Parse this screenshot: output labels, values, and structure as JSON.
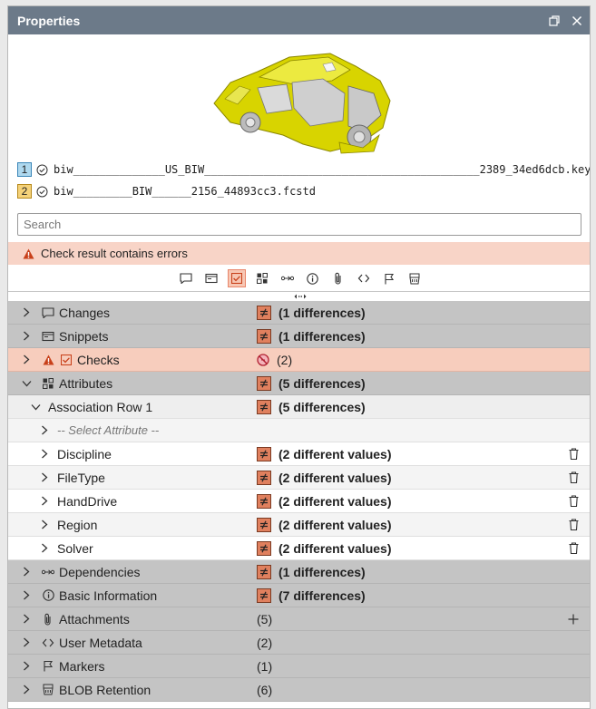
{
  "window": {
    "title": "Properties"
  },
  "files": [
    {
      "index": "1",
      "name": "biw______________US_BIW__________________________________________2389_34ed6dcb.key",
      "bg": "#aed8ee",
      "border": "#3a86b8"
    },
    {
      "index": "2",
      "name": "biw_________BIW______2156_44893cc3.fcstd",
      "bg": "#f5d27a",
      "border": "#b78a1c"
    }
  ],
  "search": {
    "placeholder": "Search",
    "value": ""
  },
  "error_banner": {
    "text": "Check result contains errors"
  },
  "toolbar": {
    "icons": [
      "changes-icon",
      "snippets-icon",
      "checks-icon",
      "attributes-icon",
      "dependencies-icon",
      "info-icon",
      "attachments-icon",
      "metadata-icon",
      "markers-icon",
      "blob-retention-icon"
    ],
    "active": "checks-icon"
  },
  "tree": {
    "changes": {
      "label": "Changes",
      "value": "(1 differences)"
    },
    "snippets": {
      "label": "Snippets",
      "value": "(1 differences)"
    },
    "checks": {
      "label": "Checks",
      "value": "(2)"
    },
    "attributes": {
      "label": "Attributes",
      "value": "(5 differences)"
    },
    "association_row": {
      "label": "Association Row 1",
      "value": "(5 differences)"
    },
    "select_attribute": {
      "label": "-- Select Attribute --"
    },
    "attribute_items": [
      {
        "label": "Discipline",
        "value": "(2 different values)"
      },
      {
        "label": "FileType",
        "value": "(2 different values)"
      },
      {
        "label": "HandDrive",
        "value": "(2 different values)"
      },
      {
        "label": "Region",
        "value": "(2 different values)"
      },
      {
        "label": "Solver",
        "value": "(2 different values)"
      }
    ],
    "dependencies": {
      "label": "Dependencies",
      "value": "(1 differences)"
    },
    "basic_information": {
      "label": "Basic Information",
      "value": "(7 differences)"
    },
    "attachments": {
      "label": "Attachments",
      "value": "(5)"
    },
    "user_metadata": {
      "label": "User Metadata",
      "value": "(2)"
    },
    "markers": {
      "label": "Markers",
      "value": "(1)"
    },
    "blob_retention": {
      "label": "BLOB Retention",
      "value": "(6)"
    }
  },
  "colors": {
    "title_bar": "#6c7a89",
    "error_bg": "#f8d4c7",
    "diff_badge": "#e0805e",
    "section_gray": "#c4c4c4",
    "car_body": "#d8d400"
  }
}
